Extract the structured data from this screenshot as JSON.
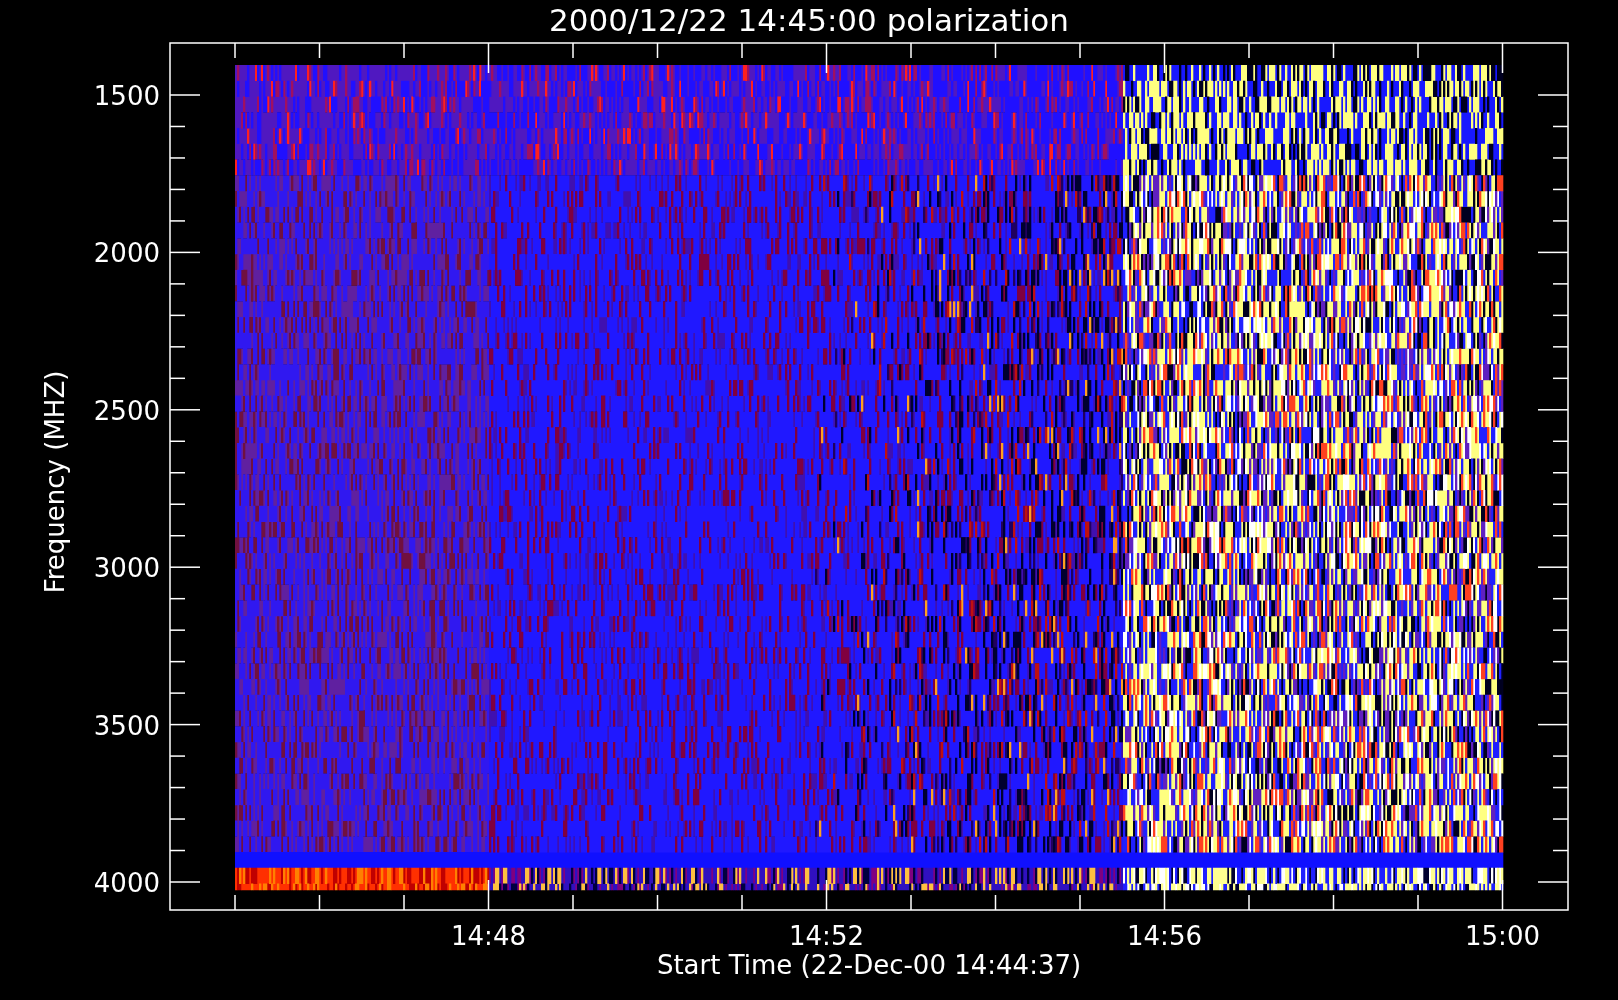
{
  "plot": {
    "title": "2000/12/22 14:45:00 polarization",
    "xlabel": "Start Time (22-Dec-00 14:44:37)",
    "ylabel": "Frequency (MHZ)",
    "yticks": [
      "1500",
      "2000",
      "2500",
      "3000",
      "3500",
      "4000"
    ],
    "xticks": [
      "14:48",
      "14:52",
      "14:56",
      "15:00"
    ]
  }
}
